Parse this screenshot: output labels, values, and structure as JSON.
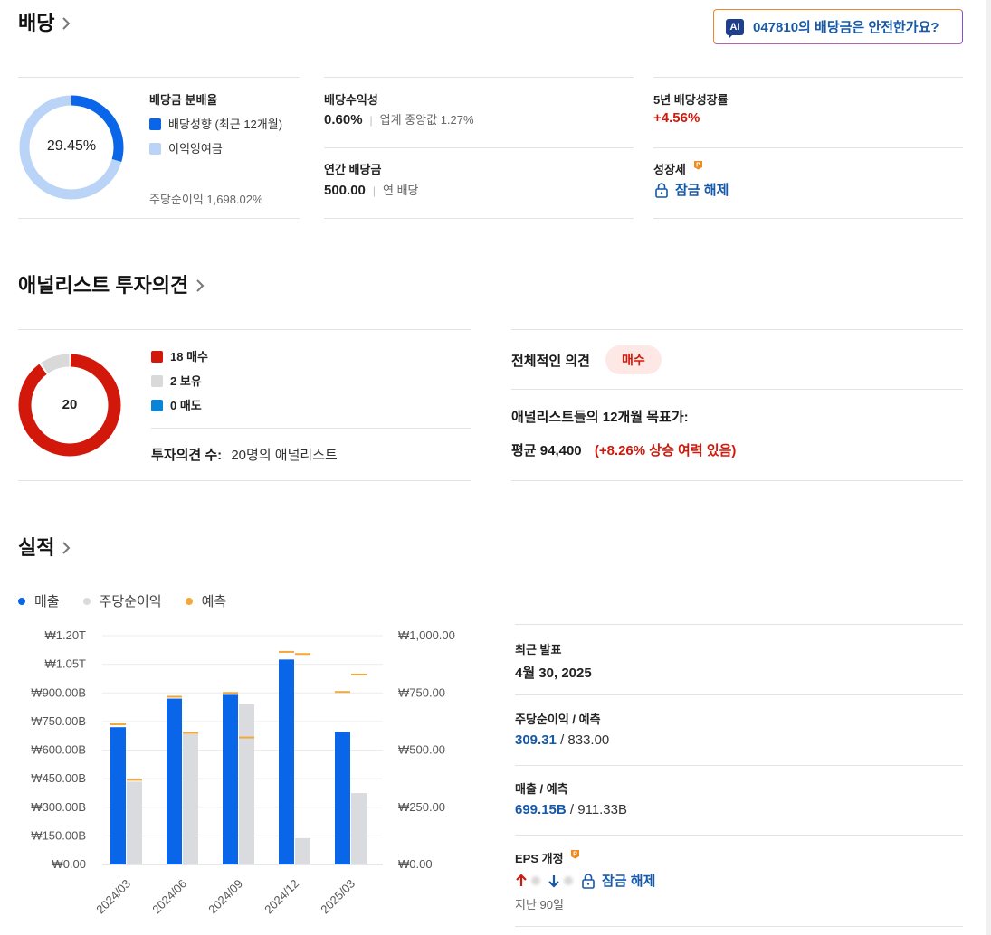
{
  "dividend": {
    "title": "배당",
    "ai_button": {
      "badge": "AI",
      "text": "047810의 배당금은 안전한가요?"
    },
    "payout": {
      "label": "배당금 분배율",
      "center": "29.45%",
      "percent": 29.45,
      "legend_paid": "배당성향 (최근 12개월)",
      "legend_retained": "이익잉여금",
      "eps_note": "주당순이익 1,698.02%",
      "color_paid": "#0a66e8",
      "color_retained": "#b9d4f7"
    },
    "yield": {
      "label": "배당수익성",
      "value": "0.60%",
      "sub": "업계 중앙값 1.27%"
    },
    "annual": {
      "label": "연간 배당금",
      "value": "500.00",
      "sub": "연 배당"
    },
    "growth5y": {
      "label": "5년 배당성장률",
      "value": "+4.56%"
    },
    "streak": {
      "label": "성장세",
      "unlock": "잠금 해제"
    }
  },
  "analyst": {
    "title": "애널리스트 투자의견",
    "total": "20",
    "legend": [
      {
        "label": "18 매수",
        "count": 18,
        "color": "#d1180b"
      },
      {
        "label": "2 보유",
        "count": 2,
        "color": "#d9d9d9"
      },
      {
        "label": "0 매도",
        "count": 0,
        "color": "#0b84d8"
      }
    ],
    "opinion_count_label": "투자의견 수:",
    "opinion_count_value": "20명의 애널리스트",
    "overall_label": "전체적인 의견",
    "overall_value": "매수",
    "target_label": "애널리스트들의 12개월 목표가:",
    "target_avg": "평균 94,400",
    "target_upside": "(+8.26% 상승 여력 있음)"
  },
  "earnings": {
    "title": "실적",
    "legend": [
      {
        "label": "매출",
        "color": "#0a66e8"
      },
      {
        "label": "주당순이익",
        "color": "#d9dbde"
      },
      {
        "label": "예측",
        "color": "#f2a83b"
      }
    ],
    "latest_label": "최근 발표",
    "latest_value": "4월 30, 2025",
    "eps_label": "주당순이익 / 예측",
    "eps_actual": "309.31",
    "eps_forecast": "/ 833.00",
    "rev_label": "매출 / 예측",
    "rev_actual": "699.15B",
    "rev_forecast": "/ 911.33B",
    "revision_label": "EPS 개정",
    "revision_unlock": "잠금 해제",
    "revision_period": "지난 90일"
  },
  "chart_data": {
    "type": "bar",
    "categories": [
      "2024/03",
      "2024/06",
      "2024/09",
      "2024/12",
      "2025/03"
    ],
    "left_axis": {
      "ticks": [
        "₩1.20T",
        "₩1.05T",
        "₩900.00B",
        "₩750.00B",
        "₩600.00B",
        "₩450.00B",
        "₩300.00B",
        "₩150.00B",
        "₩0.00"
      ],
      "ylim": [
        0,
        1200
      ]
    },
    "right_axis": {
      "ticks": [
        "₩1,000.00",
        "₩750.00",
        "₩500.00",
        "₩250.00",
        "₩0.00"
      ],
      "ylim": [
        0,
        1000
      ]
    },
    "series": [
      {
        "name": "매출",
        "axis": "left",
        "unit": "B",
        "values": [
          720,
          870,
          890,
          1075,
          695
        ],
        "forecast": [
          735,
          880,
          900,
          1115,
          905
        ]
      },
      {
        "name": "주당순이익",
        "axis": "right",
        "values": [
          362,
          570,
          700,
          115,
          312
        ],
        "forecast": [
          370,
          575,
          555,
          920,
          830
        ]
      }
    ],
    "grid": true
  }
}
